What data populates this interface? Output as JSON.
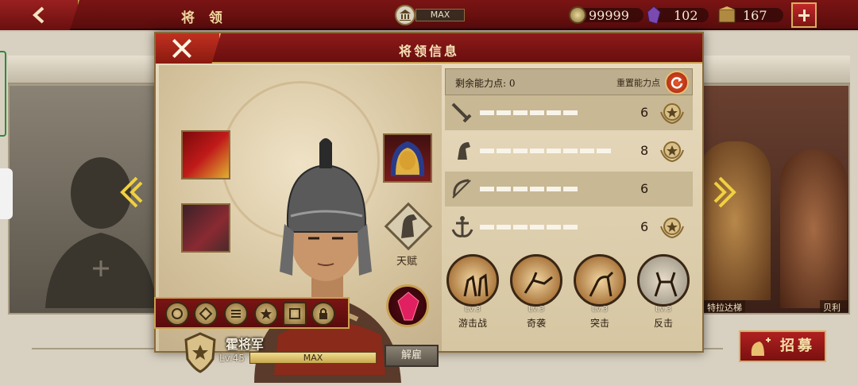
{
  "topbar": {
    "title": "将 领",
    "building_level": "MAX",
    "coins": "99999",
    "gems": "102",
    "food": "167"
  },
  "dialog": {
    "title": "将领信息",
    "talent_label": "天赋",
    "general": {
      "name": "霍将军",
      "level": "Lv.45",
      "xp_label": "MAX",
      "dismiss": "解雇"
    },
    "stats": {
      "remaining_label": "剩余能力点:",
      "remaining_value": "0",
      "reset_label": "重置能力点",
      "rows": [
        {
          "icon": "sword-icon",
          "value": "6",
          "filled": 6,
          "max": 8,
          "upgrade": true
        },
        {
          "icon": "horse-icon",
          "value": "8",
          "filled": 8,
          "max": 8,
          "upgrade": true
        },
        {
          "icon": "bow-icon",
          "value": "6",
          "filled": 6,
          "max": 8,
          "upgrade": false
        },
        {
          "icon": "anchor-icon",
          "value": "6",
          "filled": 6,
          "max": 8,
          "upgrade": true
        }
      ]
    },
    "skills": [
      {
        "level": "Lv.3",
        "name": "游击战"
      },
      {
        "level": "Lv.3",
        "name": "奇袭"
      },
      {
        "level": "Lv.3",
        "name": "突击"
      },
      {
        "level": "Lv.3",
        "name": "反击"
      }
    ]
  },
  "background": {
    "right_card_names": [
      "特拉达梯",
      "贝利撒"
    ],
    "recruit_label": "招募"
  }
}
